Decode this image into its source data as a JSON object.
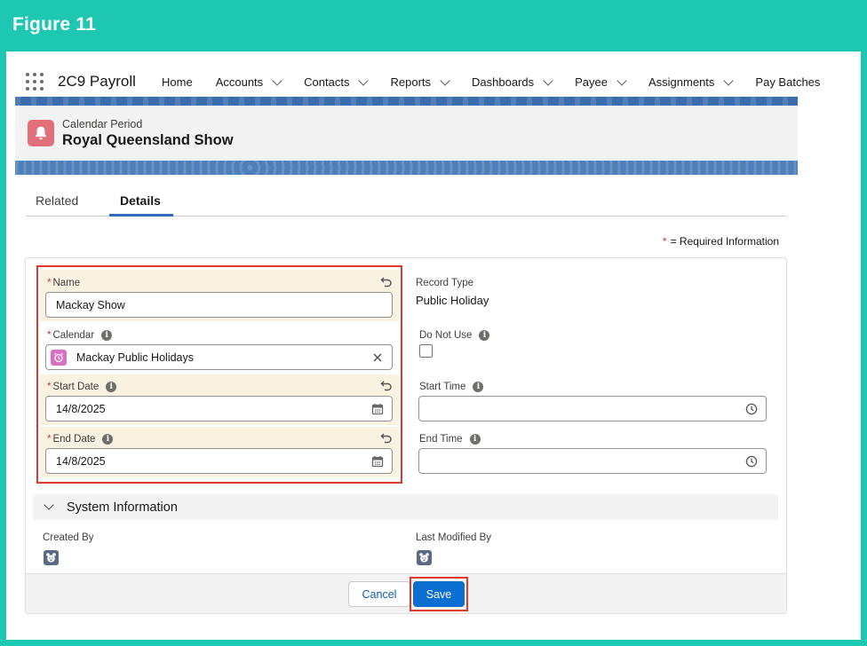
{
  "figure": {
    "label": "Figure 11"
  },
  "app": {
    "name": "2C9 Payroll"
  },
  "nav": {
    "items": [
      {
        "label": "Home",
        "has_menu": false
      },
      {
        "label": "Accounts",
        "has_menu": true
      },
      {
        "label": "Contacts",
        "has_menu": true
      },
      {
        "label": "Reports",
        "has_menu": true
      },
      {
        "label": "Dashboards",
        "has_menu": true
      },
      {
        "label": "Payee",
        "has_menu": true
      },
      {
        "label": "Assignments",
        "has_menu": true
      },
      {
        "label": "Pay Batches",
        "has_menu": false
      }
    ]
  },
  "record": {
    "type_label": "Calendar Period",
    "title": "Royal Queensland Show",
    "icon": "bell-icon"
  },
  "tabs": [
    {
      "label": "Related",
      "active": false
    },
    {
      "label": "Details",
      "active": true
    }
  ],
  "required_info": {
    "star": "*",
    "text": "= Required Information"
  },
  "form": {
    "name": {
      "label": "Name",
      "required": true,
      "value": "Mackay Show"
    },
    "calendar": {
      "label": "Calendar",
      "required": true,
      "value": "Mackay Public Holidays"
    },
    "start_date": {
      "label": "Start Date",
      "required": true,
      "value": "14/8/2025"
    },
    "end_date": {
      "label": "End Date",
      "required": true,
      "value": "14/8/2025"
    },
    "record_type": {
      "label": "Record Type",
      "value": "Public Holiday"
    },
    "do_not_use": {
      "label": "Do Not Use",
      "checked": false
    },
    "start_time": {
      "label": "Start Time",
      "value": ""
    },
    "end_time": {
      "label": "End Time",
      "value": ""
    }
  },
  "system_info": {
    "title": "System Information",
    "created_by": {
      "label": "Created By"
    },
    "last_modified_by": {
      "label": "Last Modified By"
    }
  },
  "footer": {
    "cancel_label": "Cancel",
    "save_label": "Save"
  },
  "colors": {
    "frame": "#1ec7b1",
    "brand_blue": "#0b6ed1",
    "highlight": "#e03a2f",
    "record_icon": "#e1707a"
  }
}
